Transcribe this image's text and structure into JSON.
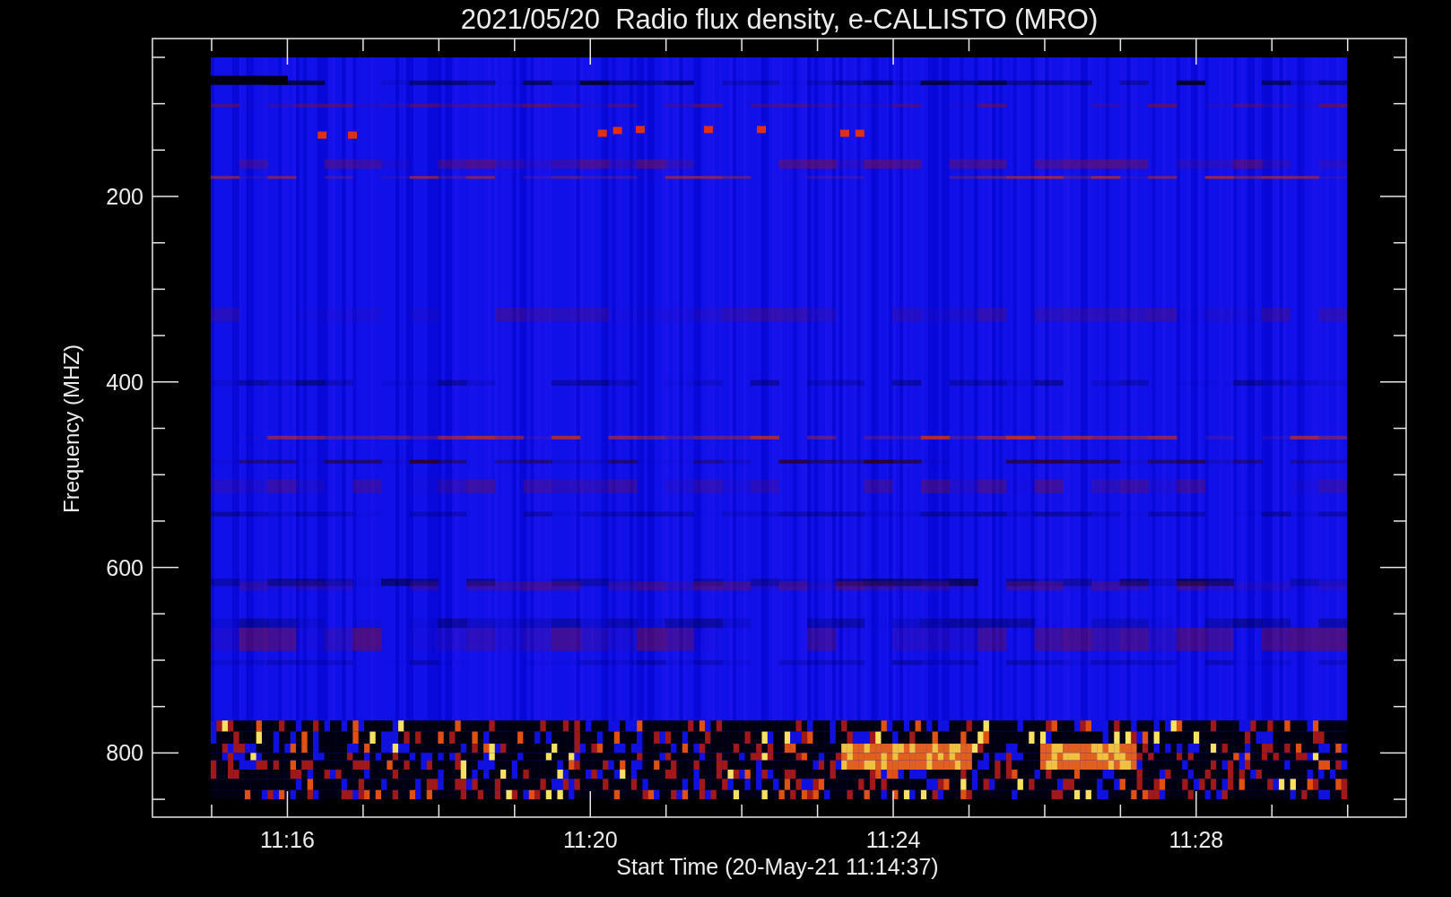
{
  "title": "2021/05/20  Radio flux density, e-CALLISTO (MRO)",
  "y_axis": {
    "label": "Frequency (MHZ)",
    "ticks": [
      "200",
      "400",
      "600",
      "800"
    ]
  },
  "x_axis": {
    "label": "Start Time (20-May-21 11:14:37)",
    "ticks": [
      "11:16",
      "11:20",
      "11:24",
      "11:28"
    ]
  }
}
